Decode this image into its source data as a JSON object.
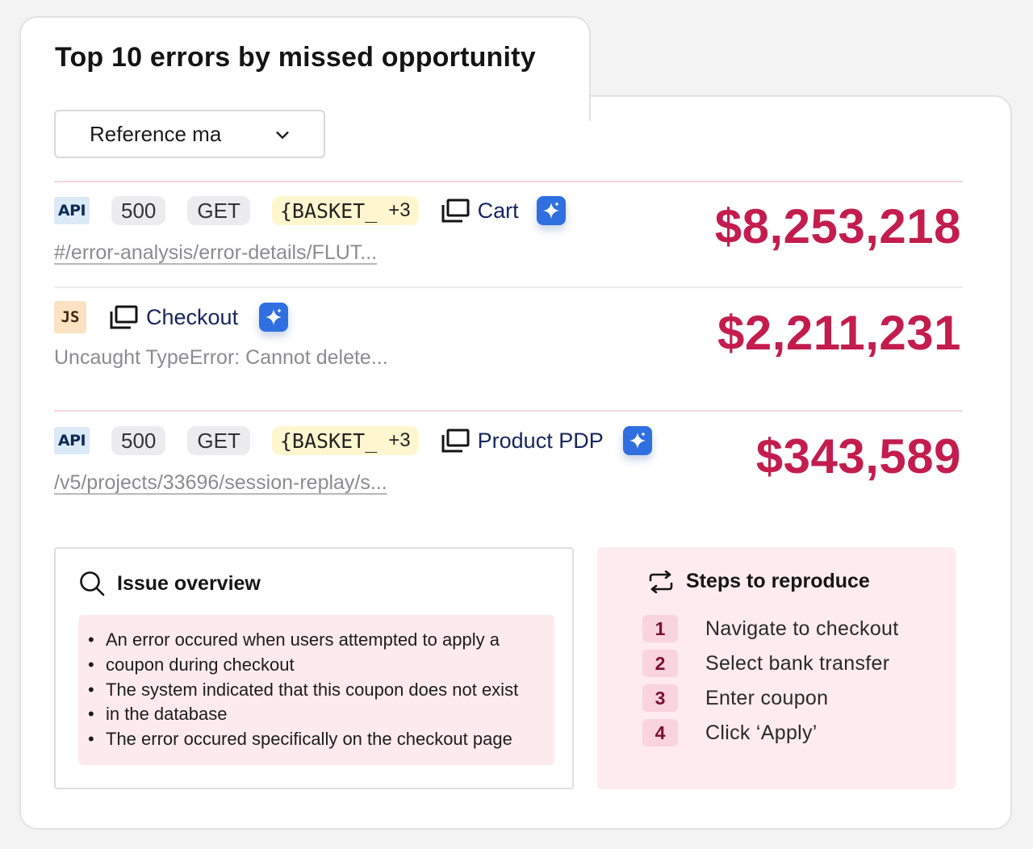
{
  "title": "Top 10 errors by missed opportunity",
  "filter": {
    "selected": "Reference ma"
  },
  "errors": [
    {
      "type": "API",
      "status": "500",
      "method": "GET",
      "param": "{BASKET_",
      "param_more": "+3",
      "page": "Cart",
      "detail": "#/error-analysis/error-details/FLUT...",
      "amount": "$8,253,218"
    },
    {
      "type": "JS",
      "page": "Checkout",
      "detail": "Uncaught TypeError: Cannot delete...",
      "amount": "$2,211,231"
    },
    {
      "type": "API",
      "status": "500",
      "method": "GET",
      "param": "{BASKET_",
      "param_more": "+3",
      "page": "Product PDP",
      "detail": "/v5/projects/33696/session-replay/s...",
      "amount": "$343,589"
    }
  ],
  "overview": {
    "title": "Issue overview",
    "bullets": [
      "An error occured when users attempted to apply a",
      "coupon during checkout",
      "The system indicated that this coupon does not exist",
      "in the database",
      "The error occured specifically on the checkout page"
    ]
  },
  "steps": {
    "title": "Steps to reproduce",
    "items": [
      {
        "num": "1",
        "text": "Navigate to checkout"
      },
      {
        "num": "2",
        "text": "Select bank transfer"
      },
      {
        "num": "3",
        "text": "Enter coupon"
      },
      {
        "num": "4",
        "text": "Click ‘Apply’"
      }
    ]
  },
  "colors": {
    "amount": "#c31d4f",
    "api_badge": "#dbeaf6",
    "js_badge": "#fbe2c2",
    "param_chip": "#fdf6cf",
    "ai_button": "#2f6fe0",
    "panel_pink": "#fdebef"
  },
  "icons": {
    "dropdown": "chevron-down-icon",
    "page": "window-stack-icon",
    "ai": "sparkle-icon",
    "overview": "search-icon",
    "steps": "repeat-icon"
  }
}
